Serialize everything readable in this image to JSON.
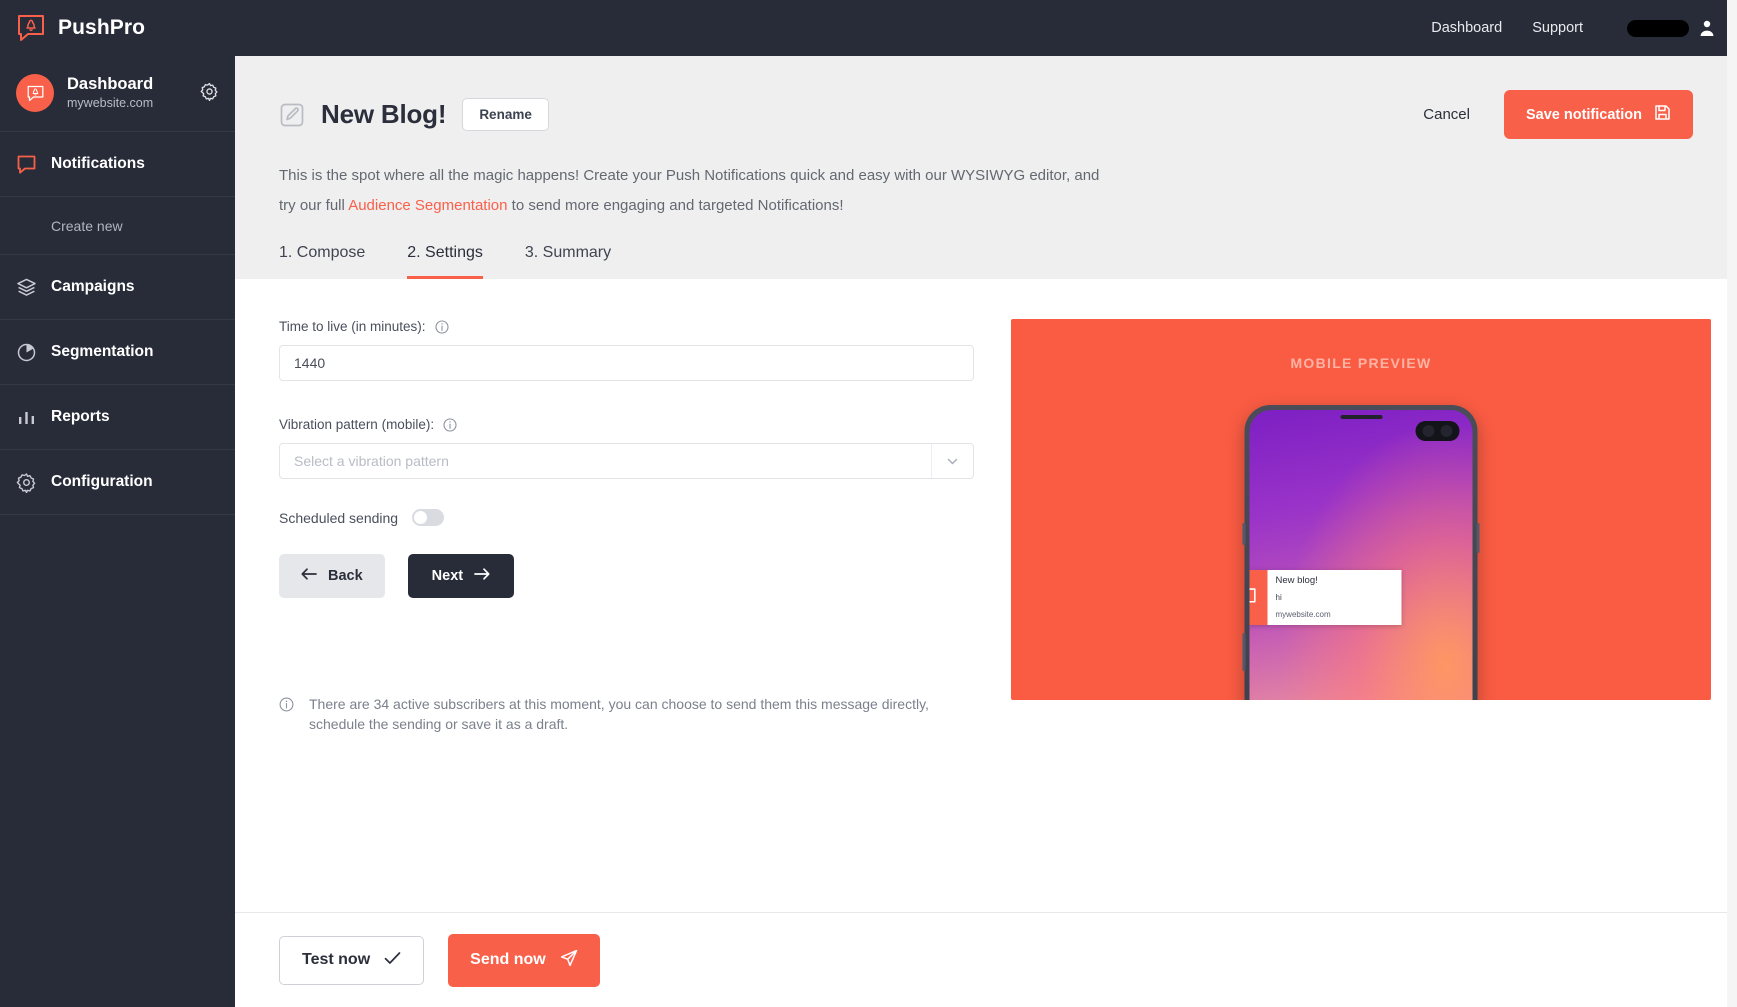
{
  "topbar": {
    "brand": "PushPro",
    "brand_logo_icon": "bell-speech-bubble-icon",
    "links": [
      {
        "label": "Dashboard",
        "name": "dashboard"
      },
      {
        "label": "Support",
        "name": "support"
      }
    ],
    "user_chip_redacted": "",
    "user_icon": "person-icon"
  },
  "sidebar": {
    "account": {
      "title": "Dashboard",
      "subtitle": "mywebsite.com",
      "avatar_icon": "bell-speech-bubble-icon",
      "gear_icon": "gear-icon"
    },
    "items": [
      {
        "label": "Notifications",
        "icon": "speech-bubble-icon",
        "sub": false
      },
      {
        "label": "Create new",
        "icon": "",
        "sub": true
      },
      {
        "label": "Campaigns",
        "icon": "layers-icon",
        "sub": false
      },
      {
        "label": "Segmentation",
        "icon": "pie-chart-icon",
        "sub": false
      },
      {
        "label": "Reports",
        "icon": "bar-chart-icon",
        "sub": false
      },
      {
        "label": "Configuration",
        "icon": "gear-icon",
        "sub": false
      }
    ]
  },
  "header": {
    "edit_icon": "pencil-square-icon",
    "title": "New Blog!",
    "rename_label": "Rename",
    "cancel_label": "Cancel",
    "save_label": "Save notification",
    "save_icon": "floppy-disk-icon",
    "intro_part1": "This is the spot where all the magic happens! Create your Push Notifications quick and easy with our WYSIWYG editor, and try our full ",
    "intro_link": "Audience Segmentation",
    "intro_part2": " to send more engaging and targeted Notifications!"
  },
  "tabs": [
    {
      "label": "1. Compose",
      "active": false
    },
    {
      "label": "2. Settings",
      "active": true
    },
    {
      "label": "3. Summary",
      "active": false
    }
  ],
  "form": {
    "ttl": {
      "label": "Time to live (in minutes):",
      "info_icon": "info-icon",
      "value": "1440"
    },
    "vibration": {
      "label": "Vibration pattern (mobile):",
      "info_icon": "info-icon",
      "placeholder": "Select a vibration pattern",
      "value": "",
      "arrow_icon": "chevron-down-icon"
    },
    "scheduled": {
      "label": "Scheduled sending",
      "state": "off"
    },
    "back_label": "Back",
    "back_icon": "arrow-left-icon",
    "next_label": "Next",
    "next_icon": "arrow-right-icon"
  },
  "preview": {
    "heading": "MOBILE PREVIEW",
    "accent_color": "#fa5c43",
    "notification": {
      "icon": "bell-speech-bubble-icon",
      "title": "New blog!",
      "message": "hi",
      "url": "mywebsite.com"
    }
  },
  "subscriber_note": {
    "info_icon": "info-icon",
    "text": "There are 34 active subscribers at this moment, you can choose to send them this message directly, schedule the sending or save it as a draft."
  },
  "footer": {
    "test_label": "Test now",
    "test_icon": "check-icon",
    "send_label": "Send now",
    "send_icon": "paper-plane-icon"
  },
  "colors": {
    "accent": "#f9604a",
    "dark": "#282c38",
    "header_bg": "#efefef"
  }
}
